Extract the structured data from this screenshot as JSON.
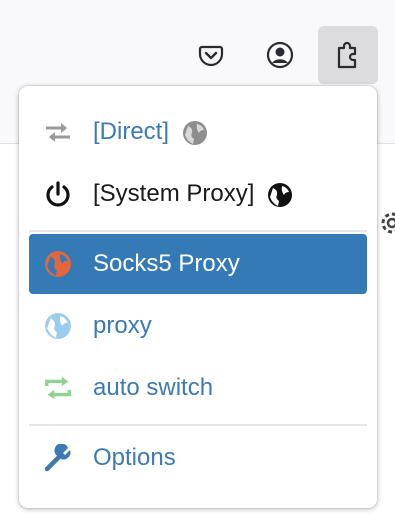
{
  "toolbar": {
    "buttons": [
      {
        "name": "pocket-icon"
      },
      {
        "name": "account-icon"
      },
      {
        "name": "extension-icon",
        "active": true
      }
    ]
  },
  "menu": {
    "items": [
      {
        "label": "[Direct]",
        "icon": "transfer-arrows-icon",
        "trailing_icon": "globe-gray-icon"
      },
      {
        "label": "[System Proxy]",
        "icon": "power-icon",
        "trailing_icon": "globe-black-icon"
      },
      {
        "label": "Socks5 Proxy",
        "icon": "globe-orange-icon",
        "selected": true
      },
      {
        "label": "proxy",
        "icon": "globe-lightblue-icon"
      },
      {
        "label": "auto switch",
        "icon": "retweet-icon"
      },
      {
        "label": "Options",
        "icon": "wrench-icon"
      }
    ]
  },
  "colors": {
    "selected_bg": "#337ab7",
    "link": "#3c7ab2",
    "socks_icon": "#e8653a",
    "proxy_icon": "#99ccee",
    "switch_icon": "#8fd18f"
  }
}
